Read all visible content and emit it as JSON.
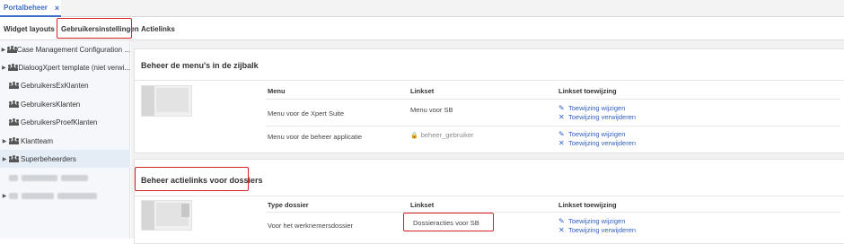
{
  "app_tab": {
    "label": "Portalbeheer",
    "close": "×"
  },
  "tabs": [
    {
      "label": "Widget layouts"
    },
    {
      "label": "Gebruikersinstellingen"
    },
    {
      "label": "Actielinks"
    }
  ],
  "sidebar": {
    "items": [
      {
        "label": "Case Management Configuration ...",
        "expandable": true
      },
      {
        "label": "DialoogXpert template (niet verwi...",
        "expandable": true
      },
      {
        "label": "GebruikersExKlanten",
        "expandable": false
      },
      {
        "label": "GebruikersKlanten",
        "expandable": false
      },
      {
        "label": "GebruikersProefKlanten",
        "expandable": false
      },
      {
        "label": "Klantteam",
        "expandable": true
      },
      {
        "label": "Superbeheerders",
        "expandable": true
      },
      {
        "label": "",
        "expandable": false,
        "redacted": true
      },
      {
        "label": "",
        "expandable": true,
        "redacted": true
      }
    ]
  },
  "menus_section": {
    "title": "Beheer de menu's in de zijbalk",
    "headers": {
      "menu": "Menu",
      "linkset": "Linkset",
      "assignment": "Linkset toewijzing"
    },
    "rows": [
      {
        "menu": "Menu voor de Xpert Suite",
        "linkset": "Menu voor SB",
        "locked": false,
        "change": "Toewijzing wijzigen",
        "remove": "Toewijzing verwijderen"
      },
      {
        "menu": "Menu voor de beheer applicatie",
        "linkset": "beheer_gebruiker",
        "locked": true,
        "change": "Toewijzing wijzigen",
        "remove": "Toewijzing verwijderen"
      }
    ]
  },
  "actions_section": {
    "title": "Beheer actielinks voor dossiers",
    "headers": {
      "type": "Type dossier",
      "linkset": "Linkset",
      "assignment": "Linkset toewijzing"
    },
    "rows": [
      {
        "type": "Voor het werknemersdossier",
        "linkset": "Dossieracties voor SB",
        "change": "Toewijzing wijzigen",
        "remove": "Toewijzing verwijderen"
      }
    ]
  },
  "icons": {
    "group": "users-group-icon",
    "edit": "edit-icon",
    "remove": "close-icon",
    "lock": "lock-icon",
    "caret": "caret-right-icon"
  },
  "colors": {
    "accent": "#3d6ec9",
    "link": "#2f5fbf",
    "highlight": "#d9212b"
  }
}
